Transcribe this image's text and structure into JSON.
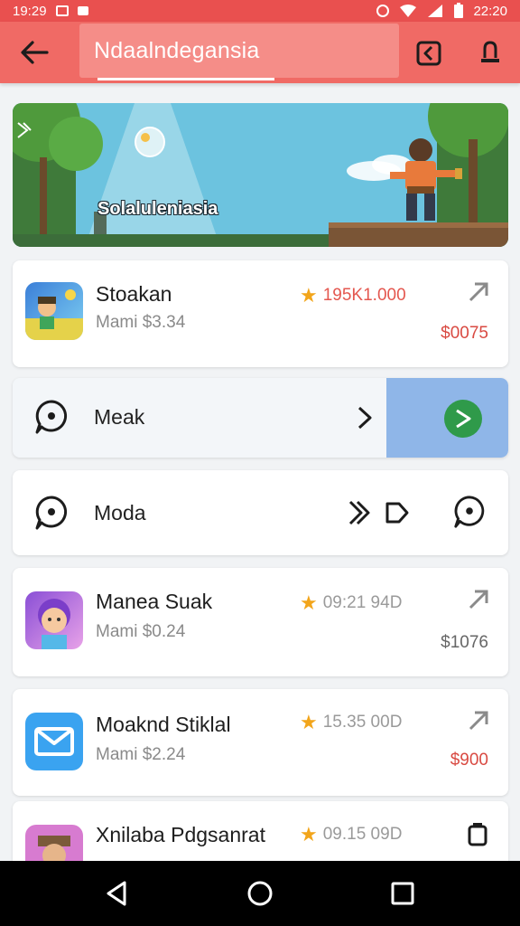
{
  "status_bar": {
    "time_left": "19:29",
    "time_right": "22:20"
  },
  "app_bar": {
    "title": "Ndaalndegansia"
  },
  "banner": {
    "caption": "Solaluleniasia"
  },
  "items": [
    {
      "title": "Stoakan",
      "subtitle": "Mami $3.34",
      "rating": "195K1.000",
      "price": "$0075",
      "price_color": "#d94a42",
      "rating_color": "#e4574f"
    },
    {
      "title": "Manea Suak",
      "subtitle": "Mami $0.24",
      "rating": "09:21 94D",
      "price": "$1076",
      "price_color": "#666666"
    },
    {
      "title": "Moaknd Stiklal",
      "subtitle": "Mami $2.24",
      "rating": "15.35 00D",
      "price": "$900",
      "price_color": "#d94a42"
    },
    {
      "title": "Xnilaba Pdgsanrat",
      "subtitle": "",
      "rating": "09.15 09D",
      "price": ""
    }
  ],
  "rows": [
    {
      "label": "Meak"
    },
    {
      "label": "Moda"
    }
  ],
  "colors": {
    "accent": "#f06a65",
    "status_bar": "#e9504f",
    "highlight": "#8fb6e8",
    "play_green": "#2f9a4a",
    "star": "#f2a51b"
  }
}
